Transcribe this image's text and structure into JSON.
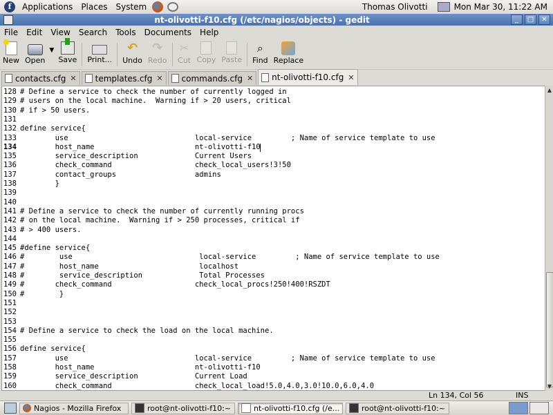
{
  "top_panel": {
    "menus": [
      "Applications",
      "Places",
      "System"
    ],
    "user": "Thomas Olivotti",
    "clock": "Mon Mar 30, 11:22 AM"
  },
  "window": {
    "title": "nt-olivotti-f10.cfg (/etc/nagios/objects) - gedit"
  },
  "menubar": [
    "File",
    "Edit",
    "View",
    "Search",
    "Tools",
    "Documents",
    "Help"
  ],
  "toolbar": {
    "new": "New",
    "open": "Open",
    "save": "Save",
    "print": "Print...",
    "undo": "Undo",
    "redo": "Redo",
    "cut": "Cut",
    "copy": "Copy",
    "paste": "Paste",
    "find": "Find",
    "replace": "Replace"
  },
  "tabs": [
    "contacts.cfg",
    "templates.cfg",
    "commands.cfg",
    "nt-olivotti-f10.cfg"
  ],
  "active_tab": "nt-olivotti-f10.cfg",
  "editor": {
    "current_line": 134,
    "lines": [
      {
        "n": "128",
        "t": "# Define a service to check the number of currently logged in"
      },
      {
        "n": "129",
        "t": "# users on the local machine.  Warning if > 20 users, critical"
      },
      {
        "n": "130",
        "t": "# if > 50 users."
      },
      {
        "n": "131",
        "t": ""
      },
      {
        "n": "132",
        "t": "define service{"
      },
      {
        "n": "133",
        "t": "        use                             local-service         ; Name of service template to use"
      },
      {
        "n": "134",
        "t": "        host_name                       nt-olivotti-f10"
      },
      {
        "n": "135",
        "t": "        service_description             Current Users"
      },
      {
        "n": "136",
        "t": "        check_command                   check_local_users!3!50"
      },
      {
        "n": "137",
        "t": "        contact_groups                  admins"
      },
      {
        "n": "138",
        "t": "        }"
      },
      {
        "n": "139",
        "t": ""
      },
      {
        "n": "140",
        "t": ""
      },
      {
        "n": "141",
        "t": "# Define a service to check the number of currently running procs"
      },
      {
        "n": "142",
        "t": "# on the local machine.  Warning if > 250 processes, critical if"
      },
      {
        "n": "143",
        "t": "# > 400 users."
      },
      {
        "n": "144",
        "t": ""
      },
      {
        "n": "145",
        "t": "#define service{"
      },
      {
        "n": "146",
        "t": "#        use                             local-service         ; Name of service template to use"
      },
      {
        "n": "147",
        "t": "#        host_name                       localhost"
      },
      {
        "n": "148",
        "t": "#        service_description             Total Processes"
      },
      {
        "n": "149",
        "t": "#       check_command                   check_local_procs!250!400!RSZDT"
      },
      {
        "n": "150",
        "t": "#        }"
      },
      {
        "n": "151",
        "t": ""
      },
      {
        "n": "152",
        "t": ""
      },
      {
        "n": "153",
        "t": ""
      },
      {
        "n": "154",
        "t": "# Define a service to check the load on the local machine."
      },
      {
        "n": "155",
        "t": ""
      },
      {
        "n": "156",
        "t": "define service{"
      },
      {
        "n": "157",
        "t": "        use                             local-service         ; Name of service template to use"
      },
      {
        "n": "158",
        "t": "        host_name                       nt-olivotti-f10"
      },
      {
        "n": "159",
        "t": "        service_description             Current Load"
      },
      {
        "n": "160",
        "t": "        check_command                   check_local_load!5.0,4.0,3.0!10.0,6.0,4.0"
      }
    ]
  },
  "statusbar": {
    "position": "Ln 134, Col 56",
    "mode": "INS"
  },
  "taskbar": {
    "tasks": [
      {
        "label": "Nagios - Mozilla Firefox",
        "icon": "firefox-icon"
      },
      {
        "label": "root@nt-olivotti-f10:~",
        "icon": "terminal-icon"
      },
      {
        "label": "nt-olivotti-f10.cfg (/e...",
        "icon": "gedit-icon"
      },
      {
        "label": "root@nt-olivotti-f10:~",
        "icon": "terminal-icon"
      }
    ]
  }
}
